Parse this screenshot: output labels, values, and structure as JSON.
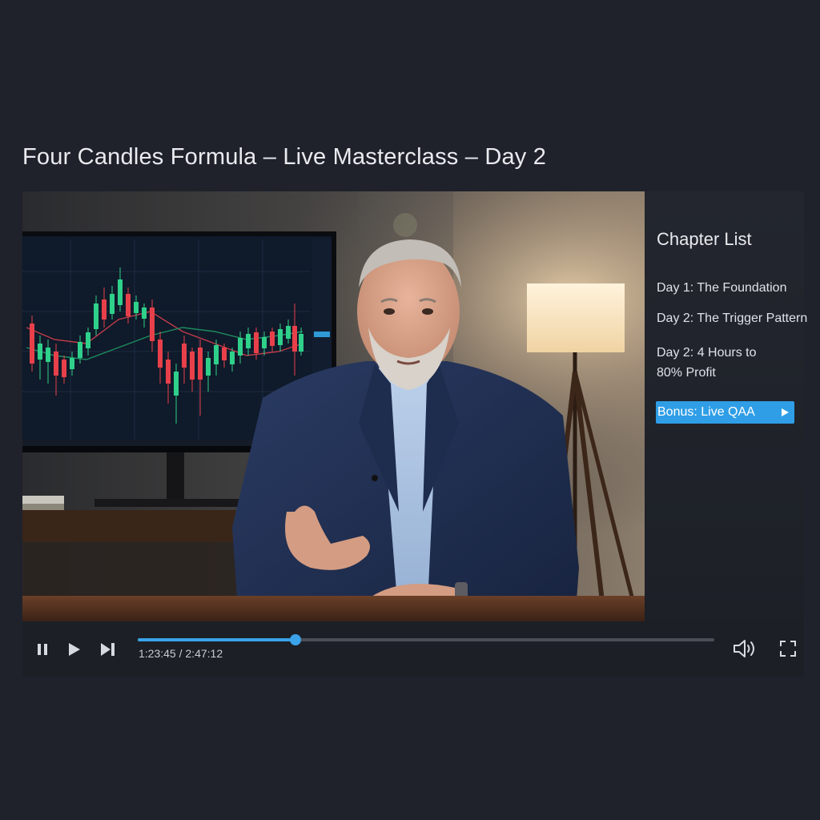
{
  "page": {
    "title": "Four Candles Formula – Live Masterclass – Day 2"
  },
  "sidebar": {
    "heading": "Chapter List",
    "chapters": [
      {
        "label": "Day 1: The Foundation",
        "active": false
      },
      {
        "label": "Day 2: The Trigger Pattern",
        "active": false
      },
      {
        "label": "Day 2: 4 Hours to 80% Profit",
        "active": false
      },
      {
        "label": "Bonus: Live QAA",
        "active": true
      }
    ]
  },
  "player": {
    "current_time": "1:23:45",
    "total_time": "2:47:12",
    "separator": "/",
    "progress": 0.274,
    "controls": [
      "pause-icon",
      "play-icon",
      "skip-next-icon",
      "volume-icon",
      "fullscreen-icon"
    ]
  },
  "colors": {
    "accent": "#3aa3ea",
    "background": "#1f222b",
    "candle_up": "#2fd08a",
    "candle_down": "#e8404a"
  }
}
